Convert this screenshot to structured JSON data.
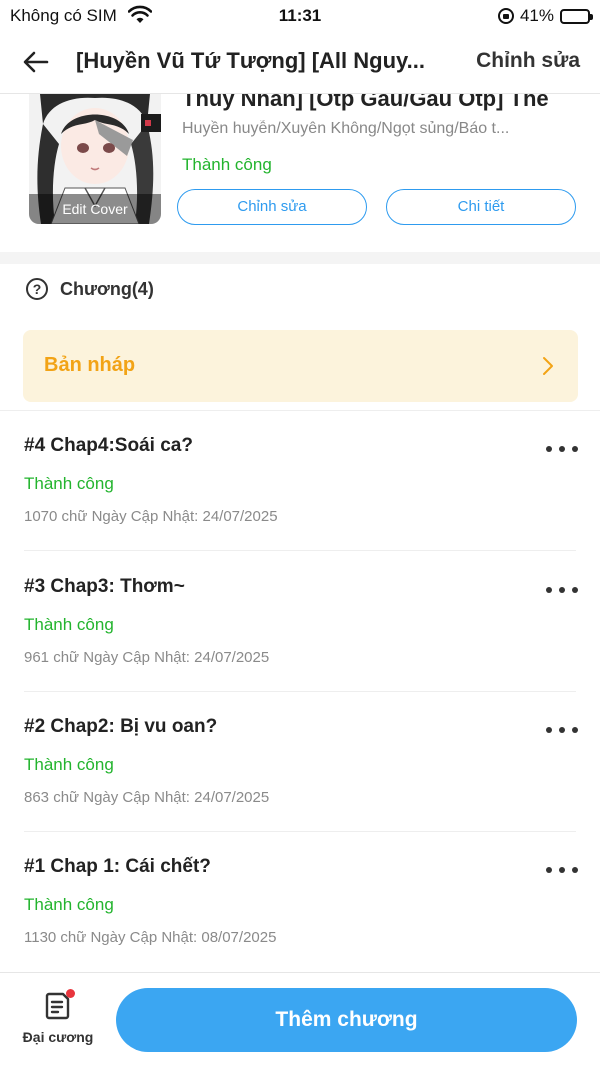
{
  "status_bar": {
    "carrier": "Không có SIM",
    "time": "11:31",
    "battery": "41%",
    "battery_level": 0.41
  },
  "header": {
    "title": "[Huyền Vũ Tứ Tượng] [All Nguy...",
    "edit_label": "Chỉnh sửa"
  },
  "book": {
    "name": "Thuỷ Nhan] [Otp Gau/Gau Otp] The",
    "genres": "Huyền huyễn/Xuyên Không/Ngọt sủng/Báo t...",
    "status": "Thành công",
    "edit_cover_label": "Edit Cover",
    "edit_button": "Chỉnh sửa",
    "detail_button": "Chi tiết"
  },
  "chapters_header": {
    "help_glyph": "?",
    "label": "Chương(4)"
  },
  "draft": {
    "label": "Bản nháp"
  },
  "chapters": [
    {
      "title": "#4 Chap4:Soái ca?",
      "status": "Thành công",
      "meta": "1070 chữ Ngày Cập Nhật: 24/07/2025"
    },
    {
      "title": "#3 Chap3: Thơm~",
      "status": "Thành công",
      "meta": "961 chữ Ngày Cập Nhật: 24/07/2025"
    },
    {
      "title": "#2 Chap2: Bị vu oan?",
      "status": "Thành công",
      "meta": "863 chữ Ngày Cập Nhật: 24/07/2025"
    },
    {
      "title": "#1 Chap 1: Cái chết?",
      "status": "Thành công",
      "meta": "1130 chữ Ngày Cập Nhật: 08/07/2025"
    }
  ],
  "bottom": {
    "outline_label": "Đại cương",
    "add_chapter_label": "Thêm chương"
  },
  "colors": {
    "accent_blue": "#3ba6f2",
    "success_green": "#23b42e",
    "draft_orange": "#f2a316",
    "draft_bg": "#fcf3dc",
    "notification_red": "#e8353d"
  },
  "icons": [
    "wifi-icon",
    "orientation-lock-icon",
    "battery-icon",
    "back-arrow-icon",
    "help-circle-icon",
    "chevron-right-icon",
    "more-icon",
    "outline-document-icon"
  ]
}
